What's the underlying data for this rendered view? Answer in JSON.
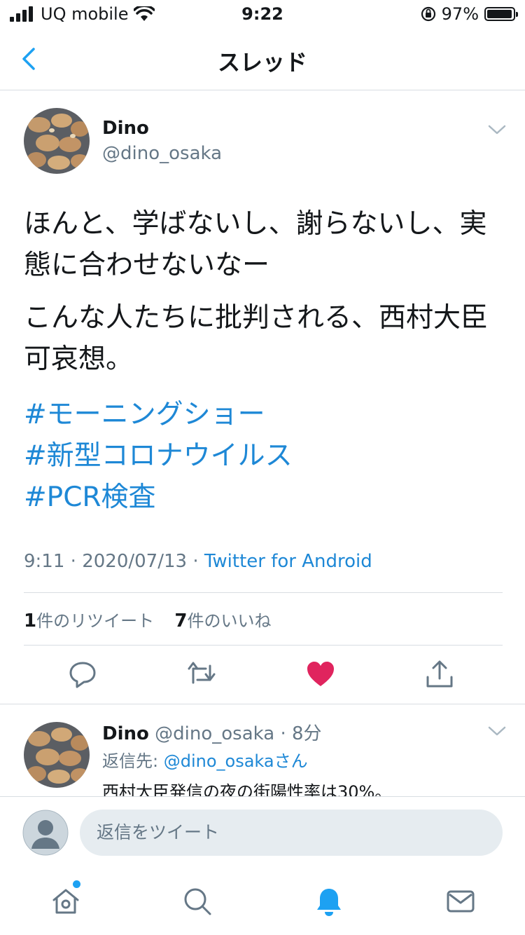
{
  "status_bar": {
    "carrier": "UQ mobile",
    "time": "9:22",
    "battery_percent": "97%",
    "battery_level": 0.97
  },
  "nav": {
    "title": "スレッド"
  },
  "tweet": {
    "display_name": "Dino",
    "handle": "@dino_osaka",
    "paragraphs": [
      "ほんと、学ばないし、謝らないし、実態に合わせないなー",
      "こんな人たちに批判される、西村大臣可哀想。"
    ],
    "hashtags": [
      "#モーニングショー",
      "#新型コロナウイルス",
      "#PCR検査"
    ],
    "time": "9:11",
    "date": "2020/07/13",
    "source": "Twitter for Android",
    "retweet_count": "1",
    "retweet_label": "件のリツイート",
    "like_count": "7",
    "like_label": "件のいいね",
    "liked_color": "#e0245e",
    "accent_color": "#1da1f2"
  },
  "reply": {
    "display_name": "Dino",
    "handle": "@dino_osaka",
    "age": "8分",
    "replying_to_label": "返信先:",
    "replying_to_handle": "@dino_osaka",
    "replying_to_suffix": "さん",
    "text": "西村大臣発信の夜の街陽性率は30%。"
  },
  "composer": {
    "placeholder": "返信をツイート"
  },
  "tabbar": {
    "items": [
      "home-icon",
      "search-icon",
      "notifications-icon",
      "messages-icon"
    ],
    "active": "notifications-icon"
  }
}
